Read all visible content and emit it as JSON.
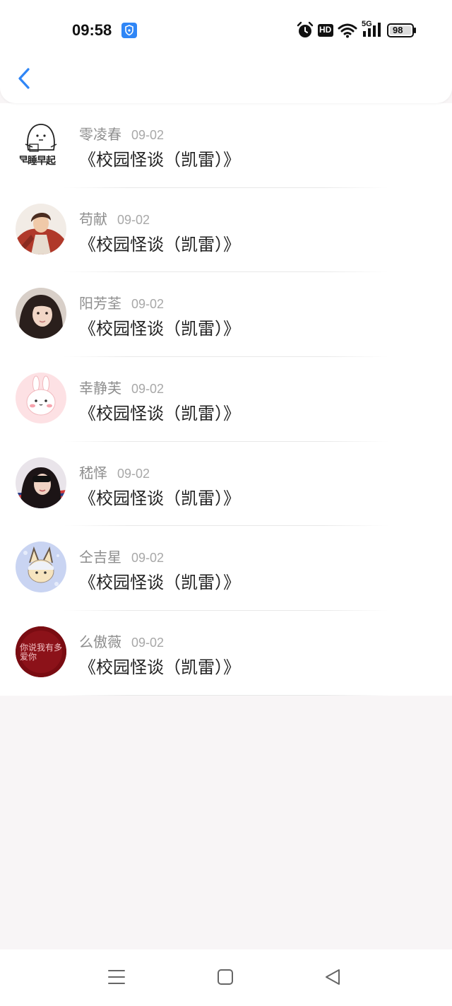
{
  "status_bar": {
    "time": "09:58",
    "battery": "98",
    "network": "5G",
    "hd_label": "HD",
    "icons": [
      "shield-app-icon",
      "alarm-icon",
      "hd-icon",
      "wifi-icon",
      "signal-5g-icon",
      "battery-icon"
    ]
  },
  "nav": {
    "back_icon": "chevron-left-icon",
    "accent_color": "#2f86f6"
  },
  "list": {
    "items": [
      {
        "name": "零凌春",
        "date": "09-02",
        "title": "《校园怪谈（凯雷）》",
        "avatar_text": "早睡早起"
      },
      {
        "name": "苟献",
        "date": "09-02",
        "title": "《校园怪谈（凯雷）》"
      },
      {
        "name": "阳芳荃",
        "date": "09-02",
        "title": "《校园怪谈（凯雷）》"
      },
      {
        "name": "幸静芙",
        "date": "09-02",
        "title": "《校园怪谈（凯雷）》"
      },
      {
        "name": "嵇怿",
        "date": "09-02",
        "title": "《校园怪谈（凯雷）》"
      },
      {
        "name": "仝吉星",
        "date": "09-02",
        "title": "《校园怪谈（凯雷）》"
      },
      {
        "name": "么傲薇",
        "date": "09-02",
        "title": "《校园怪谈（凯雷）》",
        "avatar_text": "你说我有多爱你"
      }
    ]
  },
  "system_nav": {
    "icons": [
      "menu-icon",
      "home-square-icon",
      "back-triangle-icon"
    ]
  }
}
